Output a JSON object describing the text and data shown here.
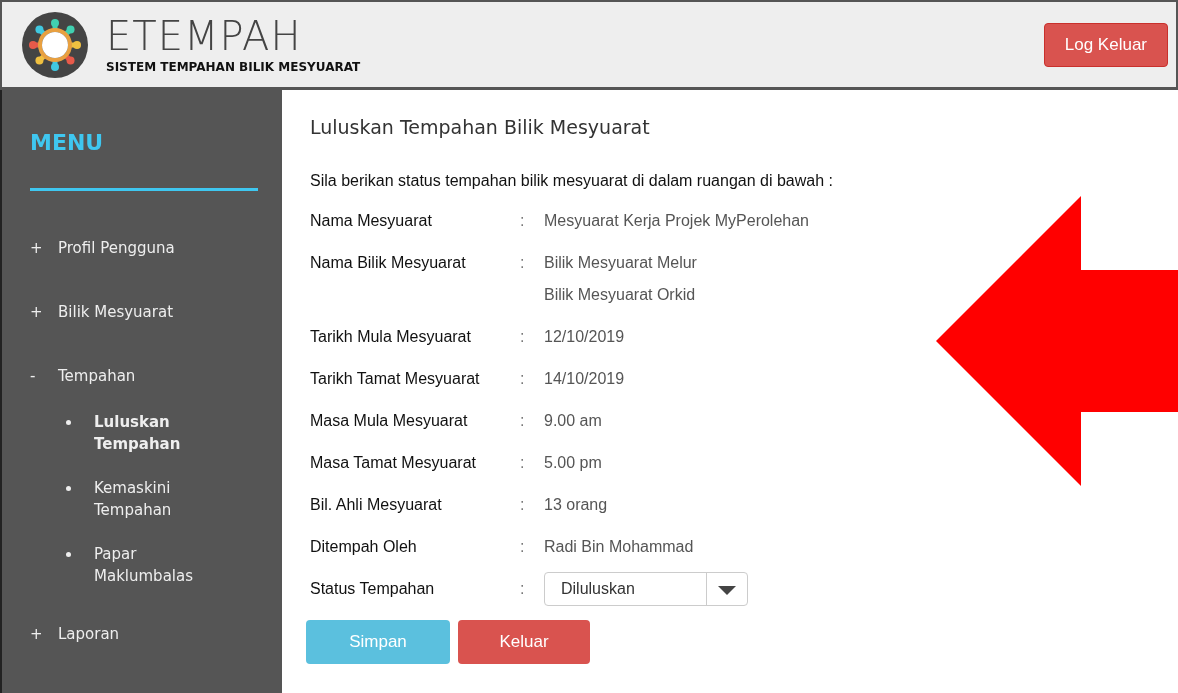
{
  "header": {
    "logo_title": "ETEMPAH",
    "logo_subtitle": "SISTEM TEMPAHAN BILIK MESYUARAT",
    "logout": "Log Keluar"
  },
  "sidebar": {
    "title": "MENU",
    "items": [
      {
        "sign": "+",
        "label": "Profil Pengguna"
      },
      {
        "sign": "+",
        "label": "Bilik Mesyuarat"
      },
      {
        "sign": "-",
        "label": "Tempahan",
        "children": [
          {
            "label": "Luluskan Tempahan",
            "selected": true
          },
          {
            "label": "Kemaskini Tempahan",
            "selected": false
          },
          {
            "label": "Papar Maklumbalas",
            "selected": false
          }
        ]
      },
      {
        "sign": "+",
        "label": "Laporan"
      }
    ]
  },
  "content": {
    "title": "Luluskan Tempahan Bilik Mesyuarat",
    "instruction": "Sila berikan status tempahan bilik mesyuarat di dalam ruangan di bawah :",
    "fields": [
      {
        "label": "Nama Mesyuarat",
        "values": [
          "Mesyuarat Kerja Projek MyPerolehan"
        ]
      },
      {
        "label": "Nama Bilik Mesyuarat",
        "values": [
          "Bilik Mesyuarat Melur",
          "Bilik Mesyuarat Orkid"
        ]
      },
      {
        "label": "Tarikh Mula Mesyuarat",
        "values": [
          "12/10/2019"
        ]
      },
      {
        "label": "Tarikh Tamat Mesyuarat",
        "values": [
          "14/10/2019"
        ]
      },
      {
        "label": "Masa Mula Mesyuarat",
        "values": [
          "9.00 am"
        ]
      },
      {
        "label": "Masa Tamat Mesyuarat",
        "values": [
          "5.00 pm"
        ]
      },
      {
        "label": "Bil. Ahli Mesyuarat",
        "values": [
          "13 orang"
        ]
      },
      {
        "label": "Ditempah Oleh",
        "values": [
          "Radi Bin Mohammad"
        ]
      }
    ],
    "separator": ":",
    "status": {
      "label": "Status Tempahan",
      "value": "Diluluskan"
    },
    "buttons": [
      {
        "label": "Simpan",
        "kind": "primary"
      },
      {
        "label": "Keluar",
        "kind": "danger"
      }
    ]
  }
}
